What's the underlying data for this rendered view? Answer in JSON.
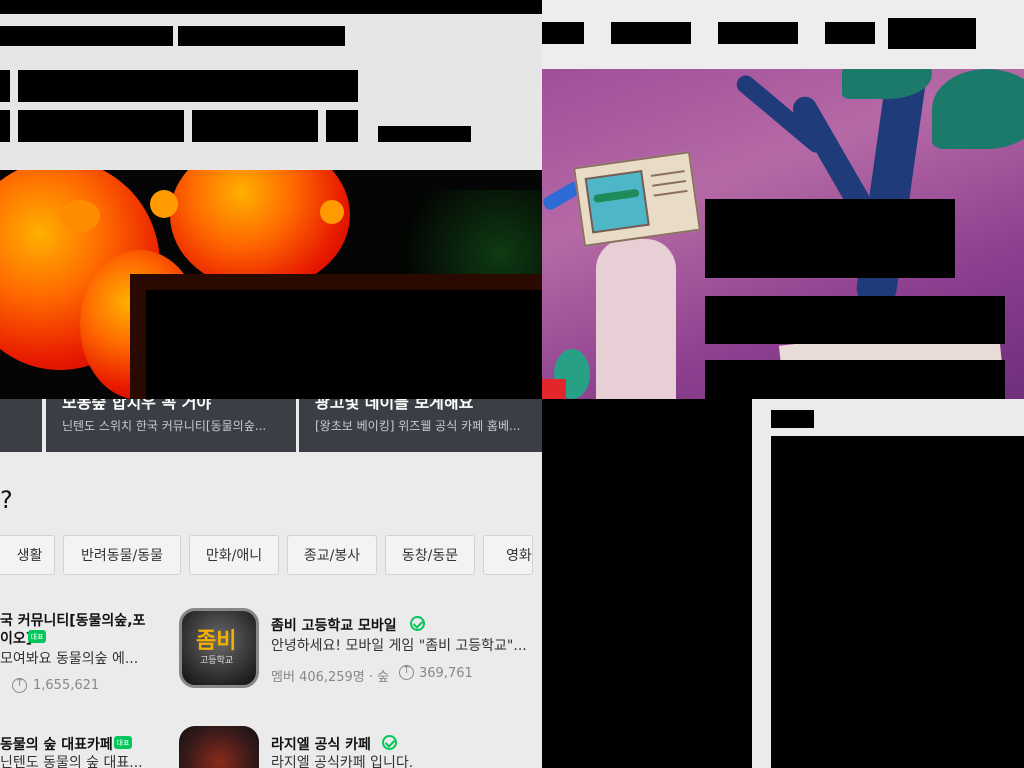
{
  "left": {
    "cards": [
      {
        "title_fragment": "모동숲 합치우 꼭 거야",
        "desc": "닌텐도 스위치 한국 커뮤니티[동물의숲..."
      },
      {
        "title_fragment": "광고및 데이블 보게해요",
        "desc": "[왕초보 베이킹] 위즈웰 공식 카페 홈베..."
      }
    ],
    "question_mark": "?",
    "chips": [
      "생활",
      "반려동물/동물",
      "만화/애니",
      "종교/봉사",
      "동창/동문",
      "영화"
    ],
    "cafes": [
      {
        "title_a": "국 커뮤니티[동물의숲,포",
        "title_b": "이오]",
        "badge": "대표",
        "desc": "모여봐요 동물의숲 에...",
        "upvotes": "1,655,621"
      },
      {
        "title": "좀비 고등학교 모바일",
        "thumb_text": "좀비",
        "thumb_sub": "고등학교",
        "desc": "안녕하세요! 모바일 게임 \"좀비 고등학교\"...",
        "members": "멤버 406,259명 · 숲",
        "upvotes": "369,761"
      },
      {
        "title": "동물의 숲 대표카페",
        "badge": "대표",
        "desc": "닌텐도 동물의 숲 대표..."
      },
      {
        "title": "라지엘 공식 카페",
        "desc": "라지엘 공식카페 입니다."
      }
    ]
  },
  "colors": {
    "naver_green": "#03c75a",
    "card_bg": "#3b3f45",
    "page_bg": "#ebebeb"
  }
}
